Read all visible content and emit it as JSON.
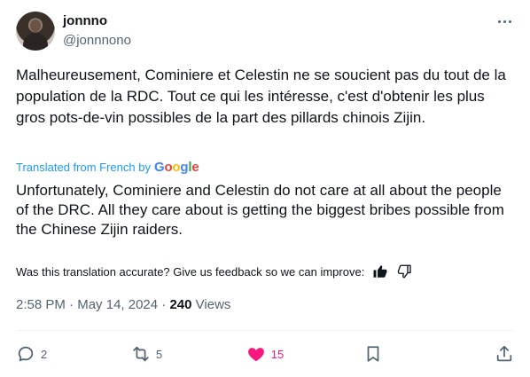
{
  "author": {
    "name": "jonnno",
    "handle": "@jonnnono"
  },
  "tweet": {
    "original_text": "Malheureusement, Cominiere et Celestin ne se soucient pas du tout de la population de la RDC. Tout ce qui les intéresse, c'est d'obtenir les plus gros pots-de-vin possibles de la part des pillards chinois Zijin.",
    "translated_label": "Translated from French by",
    "translator_brand": "Google",
    "translated_text": "Unfortunately, Cominiere and Celestin do not care at all about the people of the DRC. All they care about is getting the biggest bribes possible from the Chinese Zijin raiders.",
    "feedback_prompt": "Was this translation accurate? Give us feedback so we can improve:"
  },
  "meta": {
    "time": "2:58 PM",
    "date": "May 14, 2024",
    "separator": "·",
    "views_count": "240",
    "views_label": "Views"
  },
  "actions": {
    "replies": "2",
    "reposts": "5",
    "likes": "15"
  },
  "colors": {
    "accent": "#1d9bf0",
    "like": "#f91880",
    "secondary": "#536471",
    "primary_text": "#0f1419"
  },
  "icons": {
    "more": "more-horizontal-icon",
    "thumbs_up": "thumbs-up-icon",
    "thumbs_down": "thumbs-down-icon",
    "reply": "reply-icon",
    "repost": "repost-icon",
    "like": "heart-icon",
    "bookmark": "bookmark-icon",
    "share": "share-icon"
  }
}
